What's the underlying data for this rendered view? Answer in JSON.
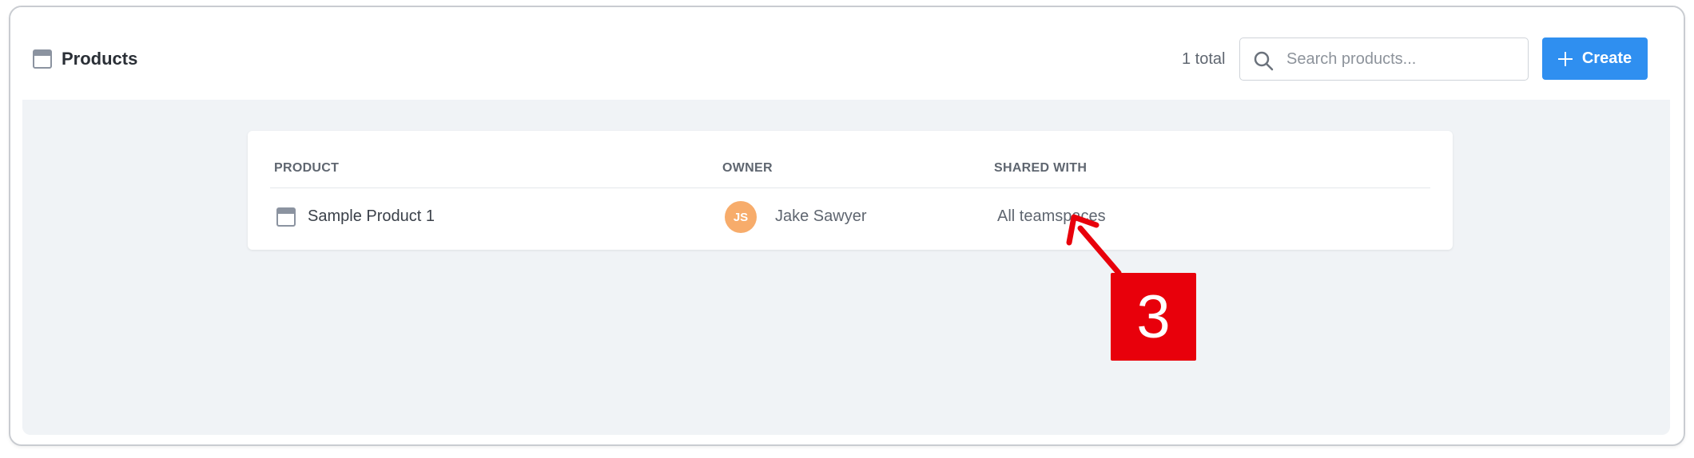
{
  "header": {
    "title": "Products",
    "title_icon": "product-window-icon",
    "total_text": "1 total",
    "search": {
      "placeholder": "Search products...",
      "value": "",
      "icon": "search-icon"
    },
    "create_label": "Create",
    "create_icon": "plus-icon"
  },
  "table": {
    "columns": [
      "PRODUCT",
      "OWNER",
      "SHARED WITH"
    ],
    "rows": [
      {
        "product": "Sample Product 1",
        "product_icon": "product-window-icon",
        "owner_initials": "JS",
        "owner_name": "Jake Sawyer",
        "shared_with": "All teamspaces"
      }
    ]
  },
  "annotation": {
    "label": "3",
    "color": "#e8000b"
  },
  "colors": {
    "accent": "#2f8ff0",
    "avatar": "#f7ac6b",
    "content_bg": "#f0f3f6",
    "annotation": "#e8000b"
  }
}
